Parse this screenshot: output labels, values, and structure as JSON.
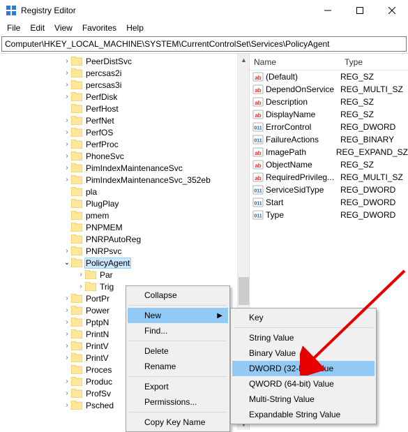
{
  "window": {
    "title": "Registry Editor"
  },
  "menu": {
    "file": "File",
    "edit": "Edit",
    "view": "View",
    "favorites": "Favorites",
    "help": "Help"
  },
  "address": "Computer\\HKEY_LOCAL_MACHINE\\SYSTEM\\CurrentControlSet\\Services\\PolicyAgent",
  "tree_items": [
    {
      "label": "PeerDistSvc",
      "chev": "closed",
      "indent": 0
    },
    {
      "label": "percsas2i",
      "chev": "closed",
      "indent": 0
    },
    {
      "label": "percsas3i",
      "chev": "closed",
      "indent": 0
    },
    {
      "label": "PerfDisk",
      "chev": "closed",
      "indent": 0
    },
    {
      "label": "PerfHost",
      "chev": "none",
      "indent": 0
    },
    {
      "label": "PerfNet",
      "chev": "closed",
      "indent": 0
    },
    {
      "label": "PerfOS",
      "chev": "closed",
      "indent": 0
    },
    {
      "label": "PerfProc",
      "chev": "closed",
      "indent": 0
    },
    {
      "label": "PhoneSvc",
      "chev": "closed",
      "indent": 0
    },
    {
      "label": "PimIndexMaintenanceSvc",
      "chev": "closed",
      "indent": 0
    },
    {
      "label": "PimIndexMaintenanceSvc_352eb",
      "chev": "closed",
      "indent": 0
    },
    {
      "label": "pla",
      "chev": "none",
      "indent": 0
    },
    {
      "label": "PlugPlay",
      "chev": "none",
      "indent": 0
    },
    {
      "label": "pmem",
      "chev": "none",
      "indent": 0
    },
    {
      "label": "PNPMEM",
      "chev": "none",
      "indent": 0
    },
    {
      "label": "PNRPAutoReg",
      "chev": "none",
      "indent": 0
    },
    {
      "label": "PNRPsvc",
      "chev": "closed",
      "indent": 0
    },
    {
      "label": "PolicyAgent",
      "chev": "open",
      "indent": 0,
      "selected": true
    },
    {
      "label": "Par",
      "chev": "closed",
      "indent": 1,
      "truncated": true
    },
    {
      "label": "Trig",
      "chev": "closed",
      "indent": 1,
      "truncated": true
    },
    {
      "label": "PortPr",
      "chev": "closed",
      "indent": 0,
      "truncated": true
    },
    {
      "label": "Power",
      "chev": "closed",
      "indent": 0,
      "truncated": true
    },
    {
      "label": "PptpN",
      "chev": "closed",
      "indent": 0,
      "truncated": true
    },
    {
      "label": "PrintN",
      "chev": "closed",
      "indent": 0,
      "truncated": true
    },
    {
      "label": "PrintV",
      "chev": "closed",
      "indent": 0,
      "truncated": true
    },
    {
      "label": "PrintV",
      "chev": "closed",
      "indent": 0,
      "truncated": true
    },
    {
      "label": "Proces",
      "chev": "none",
      "indent": 0,
      "truncated": true
    },
    {
      "label": "Produc",
      "chev": "closed",
      "indent": 0,
      "truncated": true
    },
    {
      "label": "ProfSv",
      "chev": "closed",
      "indent": 0,
      "truncated": true
    },
    {
      "label": "Psched",
      "chev": "closed",
      "indent": 0
    }
  ],
  "list": {
    "col_name": "Name",
    "col_type": "Type",
    "rows": [
      {
        "name": "(Default)",
        "type": "REG_SZ",
        "vtype": "str"
      },
      {
        "name": "DependOnService",
        "type": "REG_MULTI_SZ",
        "vtype": "str"
      },
      {
        "name": "Description",
        "type": "REG_SZ",
        "vtype": "str"
      },
      {
        "name": "DisplayName",
        "type": "REG_SZ",
        "vtype": "str"
      },
      {
        "name": "ErrorControl",
        "type": "REG_DWORD",
        "vtype": "num"
      },
      {
        "name": "FailureActions",
        "type": "REG_BINARY",
        "vtype": "num"
      },
      {
        "name": "ImagePath",
        "type": "REG_EXPAND_SZ",
        "vtype": "str"
      },
      {
        "name": "ObjectName",
        "type": "REG_SZ",
        "vtype": "str"
      },
      {
        "name": "RequiredPrivileg...",
        "type": "REG_MULTI_SZ",
        "vtype": "str"
      },
      {
        "name": "ServiceSidType",
        "type": "REG_DWORD",
        "vtype": "num"
      },
      {
        "name": "Start",
        "type": "REG_DWORD",
        "vtype": "num"
      },
      {
        "name": "Type",
        "type": "REG_DWORD",
        "vtype": "num"
      }
    ]
  },
  "ctx1": {
    "collapse": "Collapse",
    "new": "New",
    "find": "Find...",
    "delete": "Delete",
    "rename": "Rename",
    "export": "Export",
    "permissions": "Permissions...",
    "copy_key": "Copy Key Name"
  },
  "ctx2": {
    "key": "Key",
    "string": "String Value",
    "binary": "Binary Value",
    "dword": "DWORD (32-bit) Value",
    "qword": "QWORD (64-bit) Value",
    "multi": "Multi-String Value",
    "expand": "Expandable String Value"
  }
}
